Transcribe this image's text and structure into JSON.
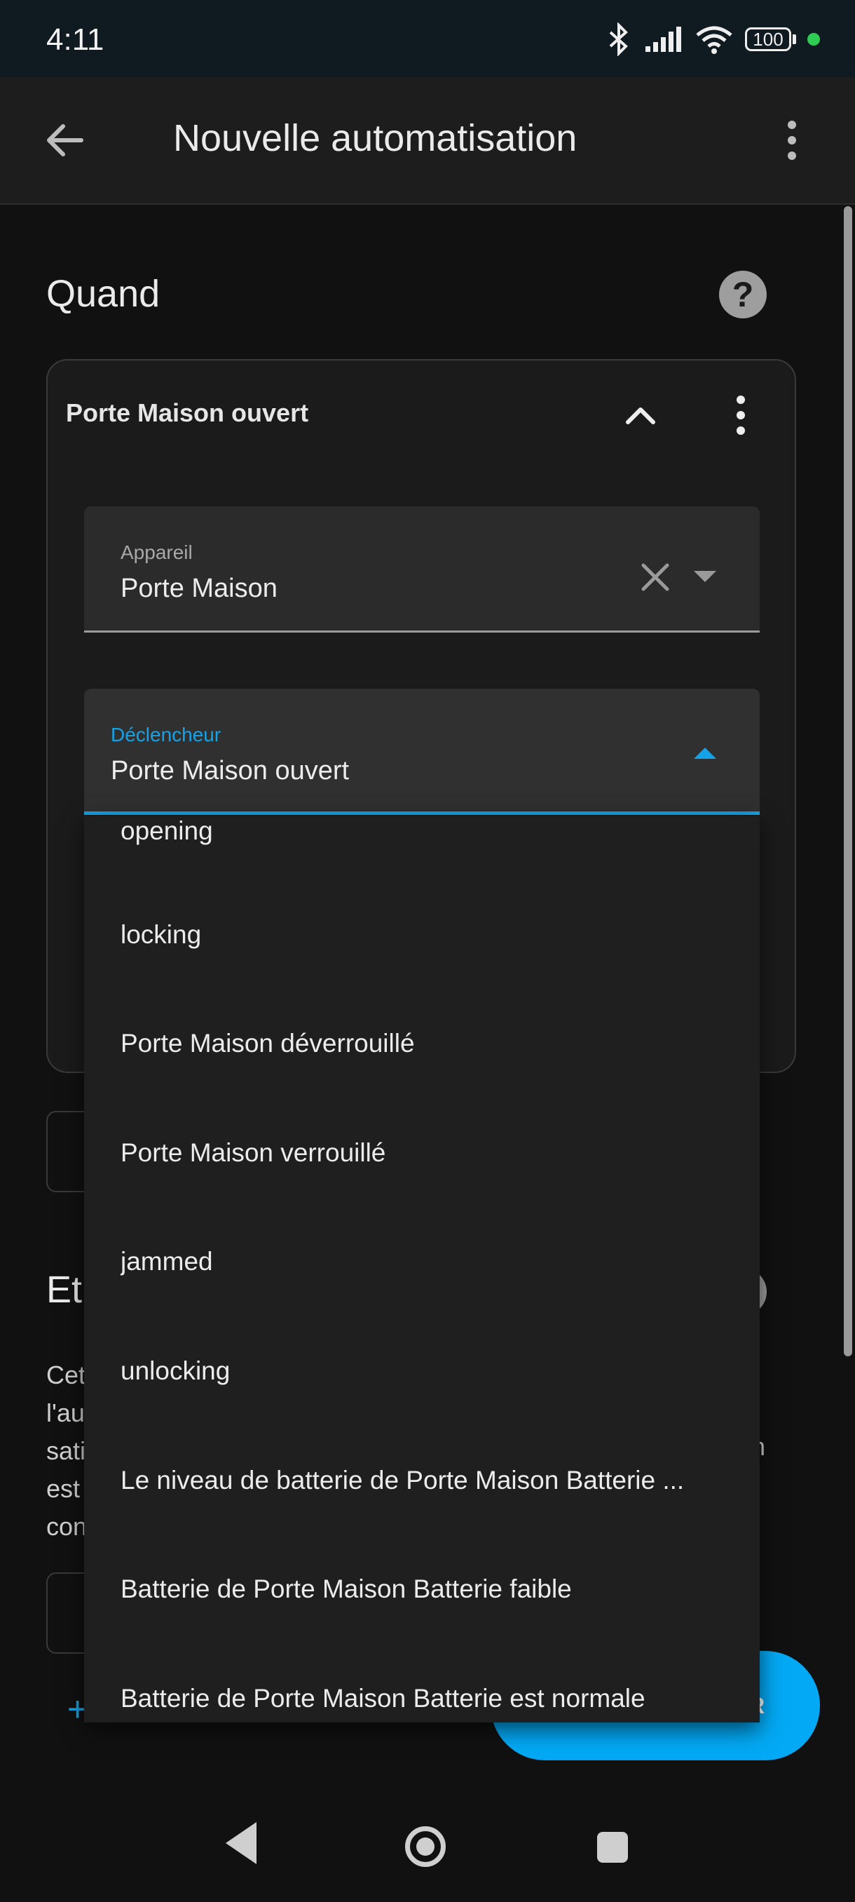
{
  "status_bar": {
    "time": "4:11",
    "battery": "100"
  },
  "app_bar": {
    "title": "Nouvelle automatisation",
    "back_icon": "arrow-left-icon",
    "more_icon": "dots-vertical-icon"
  },
  "trigger_section": {
    "heading": "Quand",
    "help_icon": "help-circle-icon"
  },
  "trigger_card": {
    "title": "Porte Maison ouvert",
    "device_field": {
      "label": "Appareil",
      "value": "Porte Maison"
    },
    "trigger_field": {
      "label": "Déclencheur",
      "value": "Porte Maison ouvert"
    }
  },
  "condition_section": {
    "heading_partial": "Et",
    "desc_partial": [
      "Cet",
      "l'au",
      "sati",
      "est",
      "con"
    ],
    "desc_partial_right": "n"
  },
  "fab": {
    "label_partial": "R"
  },
  "dropdown": {
    "items": [
      "opening",
      "locking",
      "Porte Maison déverrouillé",
      "Porte Maison verrouillé",
      "jammed",
      "unlocking",
      "Le niveau de batterie de Porte Maison Batterie ...",
      "Batterie de Porte Maison Batterie faible",
      "Batterie de Porte Maison Batterie est normale"
    ]
  },
  "colors": {
    "accent": "#14a3e6",
    "fab": "#03a9f4",
    "status_dot": "#2ecc52"
  }
}
